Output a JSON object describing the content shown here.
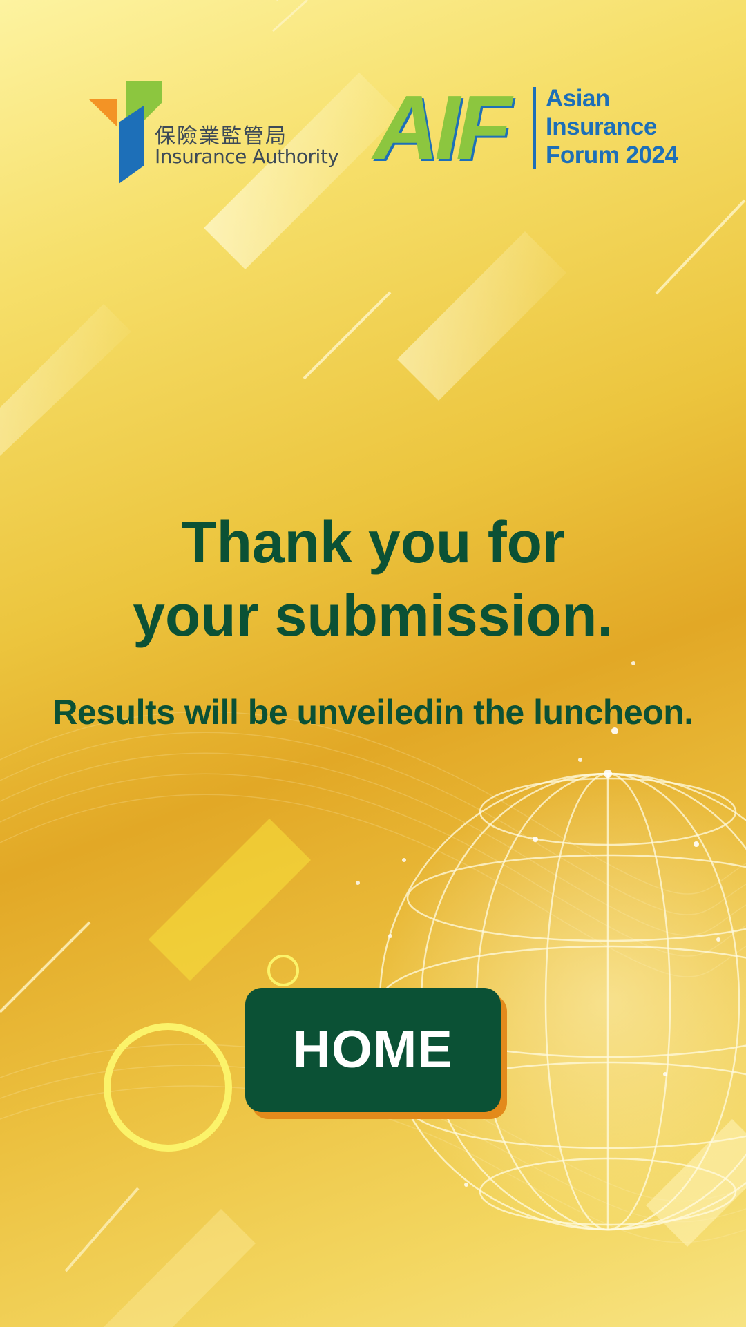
{
  "header": {
    "ia_logo": {
      "name_cn": "保險業監管局",
      "name_en": "Insurance Authority"
    },
    "aif_logo": {
      "mark": "AIF",
      "line1": "Asian",
      "line2": "Insurance",
      "line3": "Forum 2024"
    }
  },
  "main": {
    "headline_line1": "Thank you for",
    "headline_line2": "your submission.",
    "subline": "Results will be unveiledin the luncheon."
  },
  "actions": {
    "home_label": "HOME"
  },
  "colors": {
    "primary_green": "#0b5135",
    "accent_orange": "#e38a1b",
    "aif_green": "#8cc63f",
    "aif_blue": "#1d6fb8",
    "background_gold": "#ecc53e"
  }
}
